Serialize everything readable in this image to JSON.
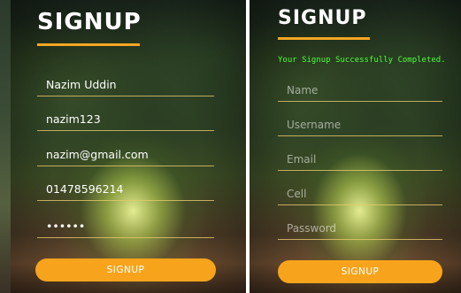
{
  "left_panel": {
    "title": "SIGNUP",
    "fields": {
      "name": "Nazim Uddin",
      "username": "nazim123",
      "email": "nazim@gmail.com",
      "cell": "01478596214",
      "password": "••••••"
    },
    "button_label": "SIGNUP"
  },
  "right_panel": {
    "title": "SIGNUP",
    "success_message": "Your Signup Successfully Completed.",
    "placeholders": {
      "name": "Name",
      "username": "Username",
      "email": "Email",
      "cell": "Cell",
      "password": "Password"
    },
    "button_label": "SIGNUP"
  },
  "colors": {
    "accent": "#f7a41c",
    "success": "#4cff3a",
    "title": "#ffffff"
  }
}
